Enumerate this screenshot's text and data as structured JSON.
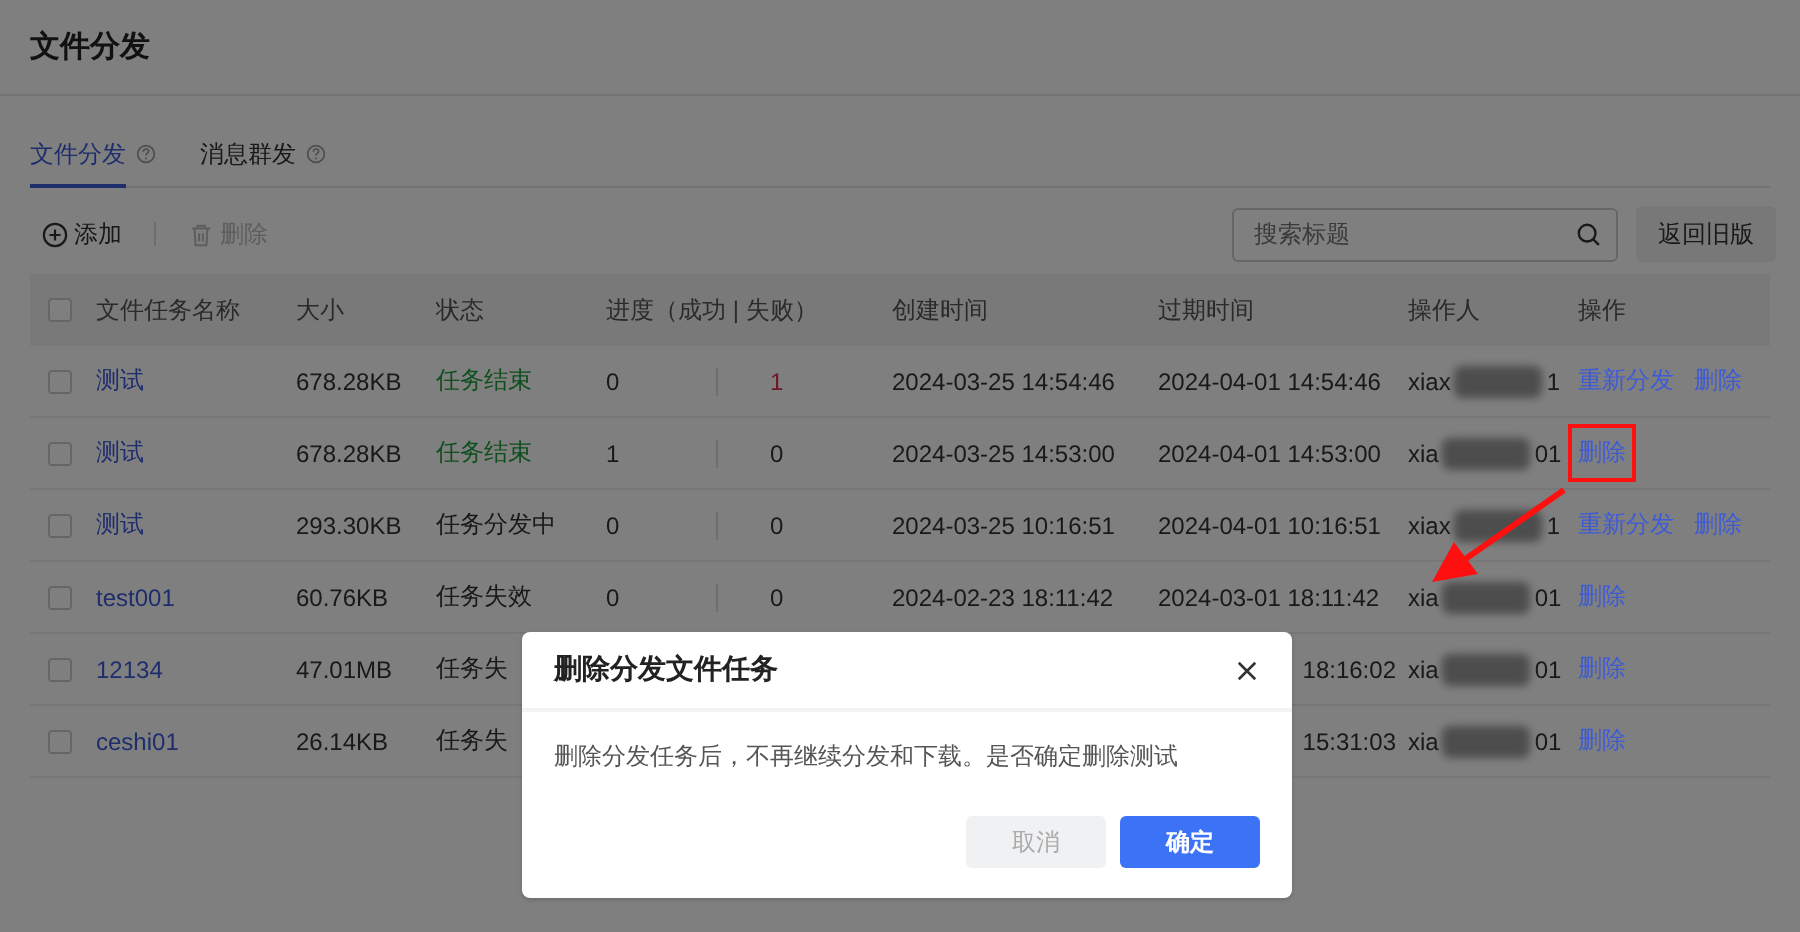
{
  "page_title": "文件分发",
  "tabs": [
    {
      "label": "文件分发",
      "selected": true
    },
    {
      "label": "消息群发",
      "selected": false
    }
  ],
  "toolbar": [
    {
      "label": "添加",
      "kind": "add",
      "disabled": false
    },
    {
      "label": "删除",
      "kind": "delete",
      "disabled": true
    }
  ],
  "search": {
    "placeholder": "搜索标题"
  },
  "back_button": "返回旧版",
  "table": {
    "select_all_checked": false,
    "columns": [
      "文件任务名称",
      "大小",
      "状态",
      "进度（成功 | 失败）",
      "创建时间",
      "过期时间",
      "操作人",
      "操作"
    ],
    "rows": [
      {
        "checked": false,
        "name": "测试",
        "size": "678.28KB",
        "status": "任务结束",
        "status_done": true,
        "success": "0",
        "fail": "1",
        "fail_alert": true,
        "created": "2024-03-25 14:54:46",
        "expires": "2024-04-01 14:54:46",
        "operator_start": "xiax",
        "operator_end": "1",
        "actions": [
          {
            "label": "重新分发",
            "highlighted": false
          },
          {
            "label": "删除",
            "highlighted": false
          }
        ]
      },
      {
        "checked": false,
        "name": "测试",
        "size": "678.28KB",
        "status": "任务结束",
        "status_done": true,
        "success": "1",
        "fail": "0",
        "fail_alert": false,
        "created": "2024-03-25 14:53:00",
        "expires": "2024-04-01 14:53:00",
        "operator_start": "xia",
        "operator_end": "01",
        "actions": [
          {
            "label": "删除",
            "highlighted": true
          }
        ]
      },
      {
        "checked": false,
        "name": "测试",
        "size": "293.30KB",
        "status": "任务分发中",
        "status_done": false,
        "success": "0",
        "fail": "0",
        "fail_alert": false,
        "created": "2024-03-25 10:16:51",
        "expires": "2024-04-01 10:16:51",
        "operator_start": "xiax",
        "operator_end": "1",
        "actions": [
          {
            "label": "重新分发",
            "highlighted": false
          },
          {
            "label": "删除",
            "highlighted": false
          }
        ]
      },
      {
        "checked": false,
        "name": "test001",
        "size": "60.76KB",
        "status": "任务失效",
        "status_done": false,
        "success": "0",
        "fail": "0",
        "fail_alert": false,
        "created": "2024-02-23 18:11:42",
        "expires": "2024-03-01 18:11:42",
        "operator_start": "xia",
        "operator_end": "01",
        "actions": [
          {
            "label": "删除",
            "highlighted": false
          }
        ]
      },
      {
        "checked": false,
        "name": "12134",
        "size": "47.01MB",
        "status": "任务失",
        "status_done": false,
        "expires": "18:16:02",
        "operator_start": "xia",
        "operator_end": "01",
        "actions": [
          {
            "label": "删除",
            "highlighted": false
          }
        ]
      },
      {
        "checked": false,
        "name": "ceshi01",
        "size": "26.14KB",
        "status": "任务失",
        "status_done": false,
        "expires": "15:31:03",
        "operator_start": "xia",
        "operator_end": "01",
        "actions": [
          {
            "label": "删除",
            "highlighted": false
          }
        ]
      }
    ]
  },
  "dialog": {
    "title": "删除分发文件任务",
    "message": "删除分发任务后，不再继续分发和下载。是否确定删除测试",
    "buttons": [
      {
        "label": "取消",
        "kind": "cancel",
        "disabled": true
      },
      {
        "label": "确定",
        "kind": "primary"
      }
    ]
  }
}
